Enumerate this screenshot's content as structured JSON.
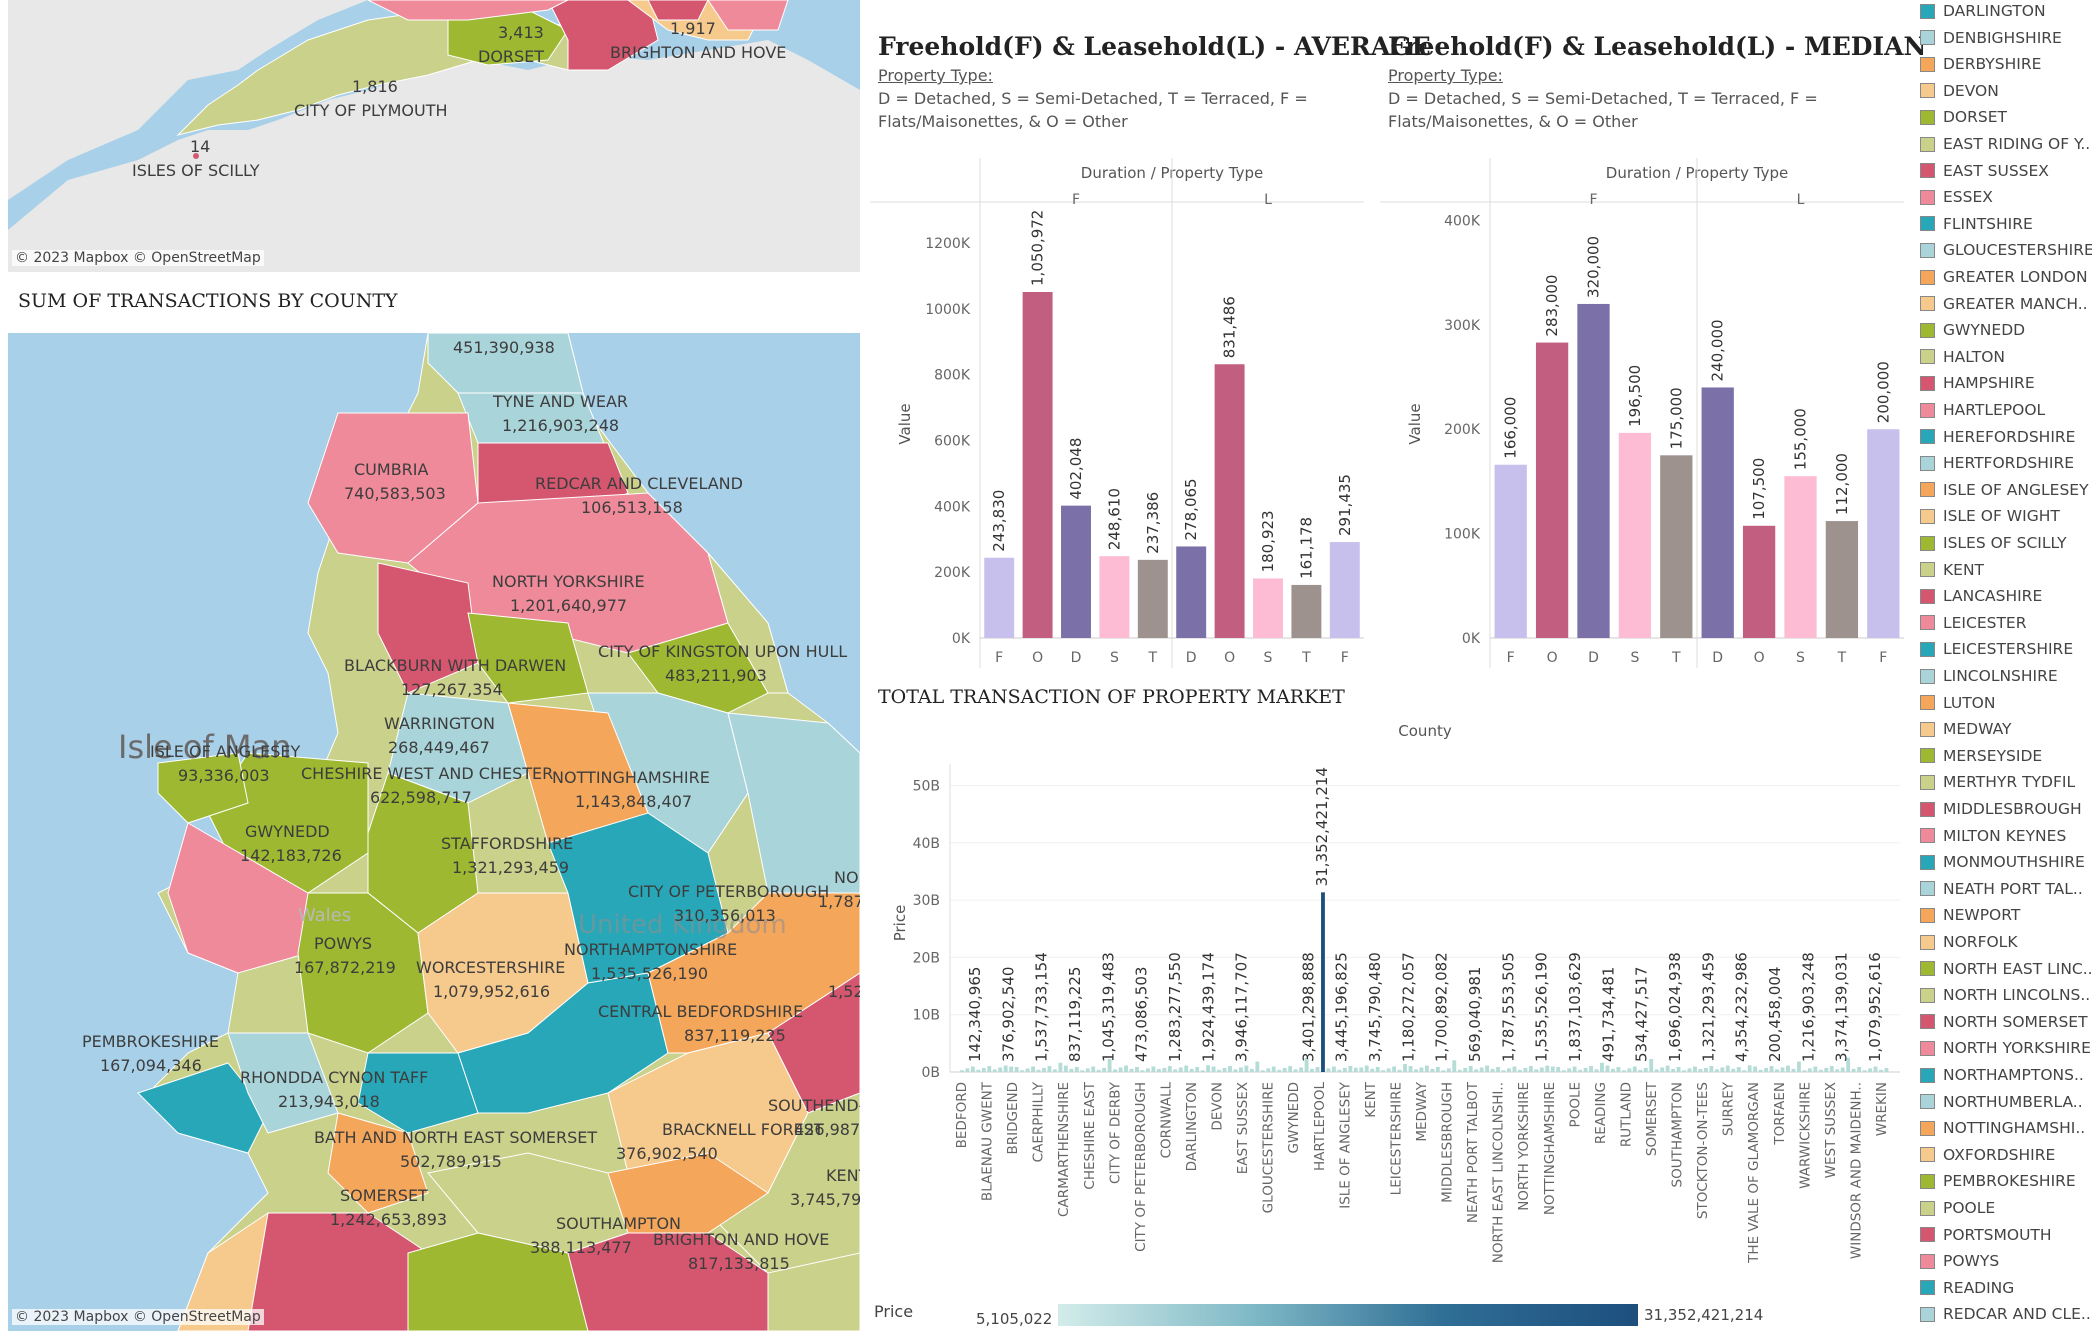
{
  "colors": {
    "pink": "#ef8a9a",
    "rose": "#d4566f",
    "teal": "#28a7b8",
    "lightteal": "#a9d4da",
    "orange": "#f4a65b",
    "peach": "#f6c98d",
    "olive": "#9fb832",
    "khaki": "#c9d18a",
    "purple": "#7b70a8",
    "lavender": "#c8c0ec",
    "lightpink": "#fdbcd4",
    "taupe": "#9e928f",
    "sea": "#a8d0e8",
    "land": "#e9e9e9"
  },
  "top_map": {
    "attribution": "© 2023 Mapbox © OpenStreetMap",
    "labels": [
      {
        "name": "DORSET",
        "value": "3,413"
      },
      {
        "name": "BRIGHTON AND HOVE",
        "value": "1,917"
      },
      {
        "name": "CITY OF PLYMOUTH",
        "value": "1,816"
      },
      {
        "name": "ISLES OF SCILLY",
        "value": "14"
      }
    ]
  },
  "county_map": {
    "title": "SUM OF TRANSACTIONS BY COUNTY",
    "attribution": "© 2023 Mapbox © OpenStreetMap",
    "sea_labels": [
      "Isle of Man",
      "Wales",
      "United Kingdom"
    ],
    "labels": [
      {
        "name": "",
        "value": "451,390,938"
      },
      {
        "name": "TYNE AND WEAR",
        "value": "1,216,903,248"
      },
      {
        "name": "CUMBRIA",
        "value": "740,583,503"
      },
      {
        "name": "REDCAR AND CLEVELAND",
        "value": "106,513,158"
      },
      {
        "name": "NORTH YORKSHIRE",
        "value": "1,201,640,977"
      },
      {
        "name": "BLACKBURN WITH DARWEN",
        "value": "127,267,354"
      },
      {
        "name": "CITY OF KINGSTON UPON HULL",
        "value": "483,211,903"
      },
      {
        "name": "WARRINGTON",
        "value": "268,449,467"
      },
      {
        "name": "ISLE OF ANGLESEY",
        "value": "93,336,003"
      },
      {
        "name": "CHESHIRE WEST AND CHESTER",
        "value": "622,598,717"
      },
      {
        "name": "NOTTINGHAMSHIRE",
        "value": "1,143,848,407"
      },
      {
        "name": "GWYNEDD",
        "value": "142,183,726"
      },
      {
        "name": "STAFFORDSHIRE",
        "value": "1,321,293,459"
      },
      {
        "name": "CITY OF PETERBOROUGH",
        "value": "310,356,013"
      },
      {
        "name": "POWYS",
        "value": "167,872,219"
      },
      {
        "name": "WORCESTERSHIRE",
        "value": "1,079,952,616"
      },
      {
        "name": "NORTHAMPTONSHIRE",
        "value": "1,535,526,190"
      },
      {
        "name": "PEMBROKESHIRE",
        "value": "167,094,346"
      },
      {
        "name": "CENTRAL BEDFORDSHIRE",
        "value": "837,119,225"
      },
      {
        "name": "RHONDDA CYNON TAFF",
        "value": "213,943,018"
      },
      {
        "name": "BATH AND NORTH EAST SOMERSET",
        "value": "502,789,915"
      },
      {
        "name": "BRACKNELL FOREST",
        "value": "376,902,540"
      },
      {
        "name": "SOMERSET",
        "value": "1,242,653,893"
      },
      {
        "name": "SOUTHAMPTON",
        "value": "388,113,477"
      },
      {
        "name": "BRIGHTON AND HOVE",
        "value": "817,133,815"
      },
      {
        "name": "SOUTHEND-",
        "value": "426,987,"
      },
      {
        "name": "KENT",
        "value": "3,745,790"
      },
      {
        "name": "NO",
        "value": "1,787"
      },
      {
        "name": "",
        "value": "1,52"
      }
    ]
  },
  "avg_chart": {
    "title": "Freehold(F) & Leasehold(L) - AVERAGE",
    "subtitle_label": "Property Type:",
    "subtitle_text": "D = Detached,  S = Semi-Detached, T = Terraced,  F = Flats/Maisonettes,  & O = Other"
  },
  "median_chart": {
    "title": "Freehold(F) & Leasehold(L) - MEDIAN",
    "subtitle_label": "Property Type:",
    "subtitle_text": "D = Detached,  S = Semi-Detached, T = Terraced,  F = Flats/Maisonettes,  & O = Other"
  },
  "total_chart": {
    "title": "TOTAL TRANSACTION OF PROPERTY MARKET",
    "legend_label": "Price",
    "legend_min": "5,105,022",
    "legend_max": "31,352,421,214"
  },
  "chart_data": [
    {
      "type": "bar",
      "title": "Freehold(F) & Leasehold(L) - AVERAGE",
      "header": "Duration / Property Type",
      "ylabel": "Value",
      "ylim": [
        0,
        1300000
      ],
      "yticks": [
        0,
        200000,
        400000,
        600000,
        800000,
        1000000,
        1200000
      ],
      "ytick_labels": [
        "0K",
        "200K",
        "400K",
        "600K",
        "800K",
        "1000K",
        "1200K"
      ],
      "groups": [
        {
          "name": "F",
          "categories": [
            "F",
            "O",
            "D",
            "S",
            "T"
          ],
          "values": [
            243830,
            1050972,
            402048,
            248610,
            237386
          ],
          "labels": [
            "243,830",
            "1,050,972",
            "402,048",
            "248,610",
            "237,386"
          ],
          "colors": [
            "#c8c0ec",
            "#c25e80",
            "#7b70a8",
            "#fdbcd4",
            "#9e928f"
          ]
        },
        {
          "name": "L",
          "categories": [
            "D",
            "O",
            "S",
            "T",
            "F"
          ],
          "values": [
            278065,
            831486,
            180923,
            161178,
            291435
          ],
          "labels": [
            "278,065",
            "831,486",
            "180,923",
            "161,178",
            "291,435"
          ],
          "colors": [
            "#7b70a8",
            "#c25e80",
            "#fdbcd4",
            "#9e928f",
            "#c8c0ec"
          ]
        }
      ]
    },
    {
      "type": "bar",
      "title": "Freehold(F) & Leasehold(L) - MEDIAN",
      "header": "Duration / Property Type",
      "ylabel": "Value",
      "ylim": [
        0,
        410000
      ],
      "yticks": [
        0,
        100000,
        200000,
        300000,
        400000
      ],
      "ytick_labels": [
        "0K",
        "100K",
        "200K",
        "300K",
        "400K"
      ],
      "groups": [
        {
          "name": "F",
          "categories": [
            "F",
            "O",
            "D",
            "S",
            "T"
          ],
          "values": [
            166000,
            283000,
            320000,
            196500,
            175000
          ],
          "labels": [
            "166,000",
            "283,000",
            "320,000",
            "196,500",
            "175,000"
          ],
          "colors": [
            "#c8c0ec",
            "#c25e80",
            "#7b70a8",
            "#fdbcd4",
            "#9e928f"
          ]
        },
        {
          "name": "L",
          "categories": [
            "D",
            "O",
            "S",
            "T",
            "F"
          ],
          "values": [
            240000,
            107500,
            155000,
            112000,
            200000
          ],
          "labels": [
            "240,000",
            "107,500",
            "155,000",
            "112,000",
            "200,000"
          ],
          "colors": [
            "#7b70a8",
            "#c25e80",
            "#fdbcd4",
            "#9e928f",
            "#c8c0ec"
          ]
        }
      ]
    },
    {
      "type": "bar",
      "title": "TOTAL TRANSACTION OF PROPERTY MARKET",
      "header": "County",
      "ylabel": "Price",
      "ylim": [
        0,
        52000000000
      ],
      "yticks": [
        0,
        10000000000,
        20000000000,
        30000000000,
        40000000000,
        50000000000
      ],
      "ytick_labels": [
        "0B",
        "10B",
        "20B",
        "30B",
        "40B",
        "50B"
      ],
      "x_tick_labels": [
        "BEDFORD",
        "BLAENAU GWENT",
        "BRIDGEND",
        "CAERPHILLY",
        "CARMARTHENSHIRE",
        "CHESHIRE EAST",
        "CITY OF DERBY",
        "CITY OF PETERBOROUGH",
        "CORNWALL",
        "DARLINGTON",
        "DEVON",
        "EAST SUSSEX",
        "GLOUCESTERSHIRE",
        "GWYNEDD",
        "HARTLEPOOL",
        "ISLE OF ANGLESEY",
        "KENT",
        "LEICESTERSHIRE",
        "MEDWAY",
        "MIDDLESBROUGH",
        "NEATH PORT TALBOT",
        "NORTH EAST LINCOLNSHI..",
        "NORTH YORKSHIRE",
        "NOTTINGHAMSHIRE",
        "POOLE",
        "READING",
        "RUTLAND",
        "SOMERSET",
        "SOUTHAMPTON",
        "STOCKTON-ON-TEES",
        "SURREY",
        "THE VALE OF GLAMORGAN",
        "TORFAEN",
        "WARWICKSHIRE",
        "WEST SUSSEX",
        "WINDSOR AND MAIDENH..",
        "WREKIN"
      ],
      "data_labels": [
        "142,340,965",
        "376,902,540",
        "1,537,733,154",
        "837,119,225",
        "1,045,319,483",
        "473,086,503",
        "1,283,277,550",
        "1,924,439,174",
        "3,946,117,707",
        "31,352,421,214",
        "3,401,298,888",
        "3,445,196,825",
        "3,745,790,480",
        "1,180,272,057",
        "1,700,892,082",
        "569,040,981",
        "1,787,553,505",
        "1,535,526,190",
        "1,837,103,629",
        "491,734,481",
        "534,427,517",
        "1,696,024,938",
        "1,321,293,459",
        "4,354,232,986",
        "200,458,004",
        "1,216,903,248",
        "3,374,139,031",
        "1,079,952,616"
      ],
      "peak_value": 31352421214
    }
  ],
  "legend_items": [
    {
      "label": "DARLINGTON",
      "color": "#28a7b8"
    },
    {
      "label": "DENBIGHSHIRE",
      "color": "#a9d4da"
    },
    {
      "label": "DERBYSHIRE",
      "color": "#f4a65b"
    },
    {
      "label": "DEVON",
      "color": "#f6c98d"
    },
    {
      "label": "DORSET",
      "color": "#9fb832"
    },
    {
      "label": "EAST RIDING OF Y..",
      "color": "#c9d18a"
    },
    {
      "label": "EAST SUSSEX",
      "color": "#d4566f"
    },
    {
      "label": "ESSEX",
      "color": "#ef8a9a"
    },
    {
      "label": "FLINTSHIRE",
      "color": "#28a7b8"
    },
    {
      "label": "GLOUCESTERSHIRE",
      "color": "#a9d4da"
    },
    {
      "label": "GREATER LONDON",
      "color": "#f4a65b"
    },
    {
      "label": "GREATER MANCH..",
      "color": "#f6c98d"
    },
    {
      "label": "GWYNEDD",
      "color": "#9fb832"
    },
    {
      "label": "HALTON",
      "color": "#c9d18a"
    },
    {
      "label": "HAMPSHIRE",
      "color": "#d4566f"
    },
    {
      "label": "HARTLEPOOL",
      "color": "#ef8a9a"
    },
    {
      "label": "HEREFORDSHIRE",
      "color": "#28a7b8"
    },
    {
      "label": "HERTFORDSHIRE",
      "color": "#a9d4da"
    },
    {
      "label": "ISLE OF ANGLESEY",
      "color": "#f4a65b"
    },
    {
      "label": "ISLE OF WIGHT",
      "color": "#f6c98d"
    },
    {
      "label": "ISLES OF SCILLY",
      "color": "#9fb832"
    },
    {
      "label": "KENT",
      "color": "#c9d18a"
    },
    {
      "label": "LANCASHIRE",
      "color": "#d4566f"
    },
    {
      "label": "LEICESTER",
      "color": "#ef8a9a"
    },
    {
      "label": "LEICESTERSHIRE",
      "color": "#28a7b8"
    },
    {
      "label": "LINCOLNSHIRE",
      "color": "#a9d4da"
    },
    {
      "label": "LUTON",
      "color": "#f4a65b"
    },
    {
      "label": "MEDWAY",
      "color": "#f6c98d"
    },
    {
      "label": "MERSEYSIDE",
      "color": "#9fb832"
    },
    {
      "label": "MERTHYR TYDFIL",
      "color": "#c9d18a"
    },
    {
      "label": "MIDDLESBROUGH",
      "color": "#d4566f"
    },
    {
      "label": "MILTON KEYNES",
      "color": "#ef8a9a"
    },
    {
      "label": "MONMOUTHSHIRE",
      "color": "#28a7b8"
    },
    {
      "label": "NEATH PORT TAL..",
      "color": "#a9d4da"
    },
    {
      "label": "NEWPORT",
      "color": "#f4a65b"
    },
    {
      "label": "NORFOLK",
      "color": "#f6c98d"
    },
    {
      "label": "NORTH EAST LINC..",
      "color": "#9fb832"
    },
    {
      "label": "NORTH LINCOLNS..",
      "color": "#c9d18a"
    },
    {
      "label": "NORTH SOMERSET",
      "color": "#d4566f"
    },
    {
      "label": "NORTH YORKSHIRE",
      "color": "#ef8a9a"
    },
    {
      "label": "NORTHAMPTONS..",
      "color": "#28a7b8"
    },
    {
      "label": "NORTHUMBERLA..",
      "color": "#a9d4da"
    },
    {
      "label": "NOTTINGHAMSHI..",
      "color": "#f4a65b"
    },
    {
      "label": "OXFORDSHIRE",
      "color": "#f6c98d"
    },
    {
      "label": "PEMBROKESHIRE",
      "color": "#9fb832"
    },
    {
      "label": "POOLE",
      "color": "#c9d18a"
    },
    {
      "label": "PORTSMOUTH",
      "color": "#d4566f"
    },
    {
      "label": "POWYS",
      "color": "#ef8a9a"
    },
    {
      "label": "READING",
      "color": "#28a7b8"
    },
    {
      "label": "REDCAR AND CLE..",
      "color": "#a9d4da"
    }
  ]
}
